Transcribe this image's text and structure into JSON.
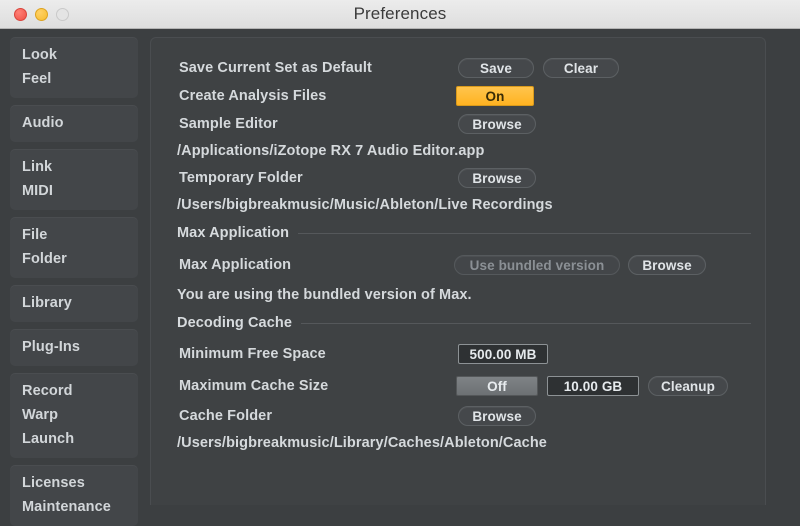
{
  "titlebar": {
    "title": "Preferences",
    "buttons": [
      {
        "name": "close-button",
        "color": "#f05045"
      },
      {
        "name": "minimize-button",
        "color": "#f7bc2e"
      },
      {
        "name": "zoom-button",
        "color": "#e4e4e4"
      }
    ]
  },
  "sidebar": {
    "groups": [
      {
        "items": [
          "Look",
          "Feel"
        ]
      },
      {
        "items": [
          "Audio"
        ]
      },
      {
        "items": [
          "Link",
          "MIDI"
        ]
      },
      {
        "items": [
          "File",
          "Folder"
        ]
      },
      {
        "items": [
          "Library"
        ]
      },
      {
        "items": [
          "Plug-Ins"
        ]
      },
      {
        "items": [
          "Record",
          "Warp",
          "Launch"
        ]
      },
      {
        "items": [
          "Licenses",
          "Maintenance"
        ]
      }
    ]
  },
  "main": {
    "rows": {
      "save_default_label": "Save Current Set as Default",
      "save_button": "Save",
      "clear_button": "Clear",
      "analysis_label": "Create Analysis Files",
      "analysis_value": "On",
      "sample_editor_label": "Sample Editor",
      "sample_editor_browse": "Browse",
      "sample_editor_path": "/Applications/iZotope RX 7 Audio Editor.app",
      "temp_folder_label": "Temporary Folder",
      "temp_folder_browse": "Browse",
      "temp_folder_path": "/Users/bigbreakmusic/Music/Ableton/Live Recordings",
      "max_section": "Max Application",
      "max_app_label": "Max Application",
      "max_bundled_button": "Use bundled version",
      "max_browse_button": "Browse",
      "max_note": "You are using the bundled version of Max.",
      "decoding_section": "Decoding Cache",
      "min_free_label": "Minimum Free Space",
      "min_free_value": "500.00 MB",
      "max_cache_label": "Maximum Cache Size",
      "max_cache_toggle": "Off",
      "max_cache_value": "10.00 GB",
      "cleanup_button": "Cleanup",
      "cache_folder_label": "Cache Folder",
      "cache_folder_browse": "Browse",
      "cache_folder_path": "/Users/bigbreakmusic/Library/Caches/Ableton/Cache"
    }
  },
  "colors": {
    "window_bg": "#3c3f41",
    "panel_bg": "#3f4244",
    "nav_group_bg": "#434649",
    "accent_amber": "#ffb321",
    "text": "#d5d9dc",
    "titlebar_bg": "#ececec"
  }
}
